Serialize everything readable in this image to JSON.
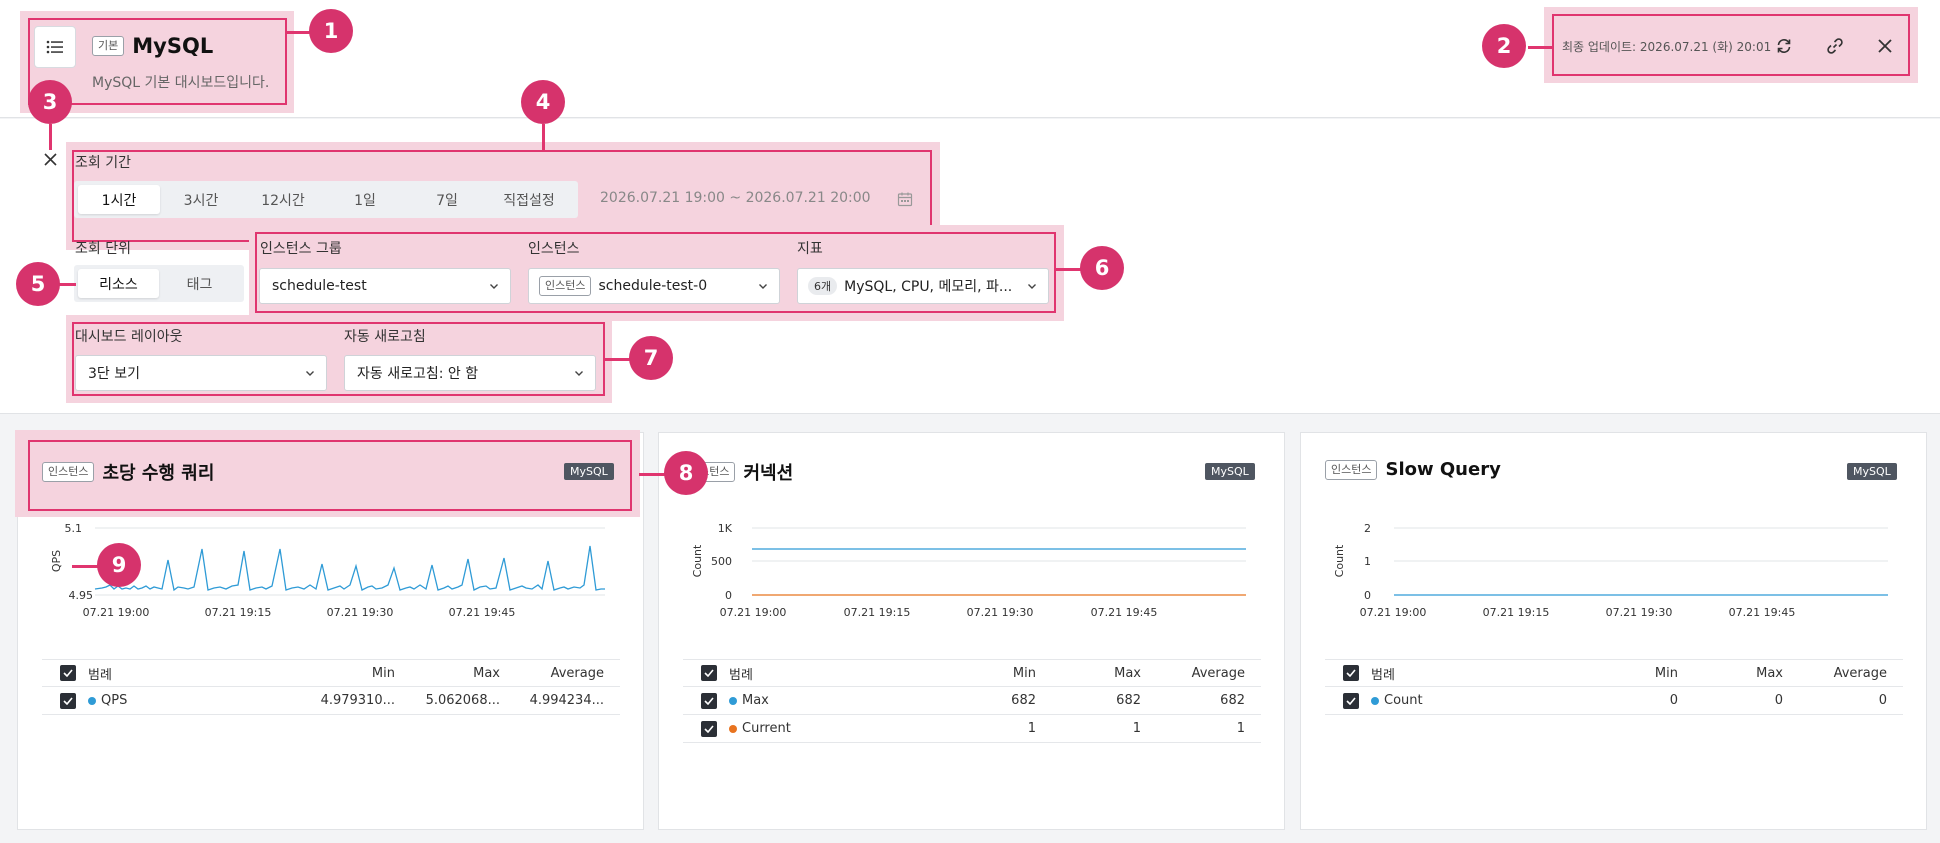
{
  "header": {
    "tag": "기본",
    "title": "MySQL",
    "subtitle": "MySQL 기본 대시보드입니다.",
    "updated": "최종 업데이트: 2026.07.21 (화) 20:01"
  },
  "period": {
    "label": "조회 기간",
    "options": [
      "1시간",
      "3시간",
      "12시간",
      "1일",
      "7일",
      "직접설정"
    ],
    "selected": "1시간",
    "range": "2026.07.21 19:00 ~ 2026.07.21 20:00"
  },
  "unit": {
    "label": "조회 단위",
    "options": [
      "리소스",
      "태그"
    ],
    "selected": "리소스"
  },
  "instance_group": {
    "label": "인스턴스 그룹",
    "value": "schedule-test"
  },
  "instance": {
    "label": "인스턴스",
    "tag": "인스턴스",
    "value": "schedule-test-0"
  },
  "metric": {
    "label": "지표",
    "count": "6개",
    "value": "MySQL, CPU, 메모리, 파..."
  },
  "layout": {
    "label": "대시보드 레이아웃",
    "value": "3단 보기"
  },
  "refresh": {
    "label": "자동 새로고침",
    "value": "자동 새로고침: 안 함"
  },
  "markers": [
    "1",
    "2",
    "3",
    "4",
    "5",
    "6",
    "7",
    "8",
    "9"
  ],
  "legend_headers": {
    "name": "범례",
    "min": "Min",
    "max": "Max",
    "avg": "Average"
  },
  "cards": [
    {
      "tag": "인스턴스",
      "title": "초당 수행 쿼리",
      "badge": "MySQL",
      "ylabel": "QPS",
      "yticks": [
        "5.1",
        "4.95"
      ],
      "xticks": [
        "07.21 19:00",
        "07.21 19:15",
        "07.21 19:30",
        "07.21 19:45"
      ],
      "legend": [
        {
          "name": "QPS",
          "color": "#2f9bd6",
          "min": "4.979310...",
          "max": "5.062068...",
          "avg": "4.994234..."
        }
      ]
    },
    {
      "tag": "인스턴스",
      "title": "커넥션",
      "badge": "MySQL",
      "ylabel": "Count",
      "yticks": [
        "1K",
        "500",
        "0"
      ],
      "xticks": [
        "07.21 19:00",
        "07.21 19:15",
        "07.21 19:30",
        "07.21 19:45"
      ],
      "legend": [
        {
          "name": "Max",
          "color": "#2f9bd6",
          "min": "682",
          "max": "682",
          "avg": "682"
        },
        {
          "name": "Current",
          "color": "#e8731f",
          "min": "1",
          "max": "1",
          "avg": "1"
        }
      ]
    },
    {
      "tag": "인스턴스",
      "title": "Slow Query",
      "badge": "MySQL",
      "ylabel": "Count",
      "yticks": [
        "2",
        "1",
        "0"
      ],
      "xticks": [
        "07.21 19:00",
        "07.21 19:15",
        "07.21 19:30",
        "07.21 19:45"
      ],
      "legend": [
        {
          "name": "Count",
          "color": "#2f9bd6",
          "min": "0",
          "max": "0",
          "avg": "0"
        }
      ]
    }
  ],
  "colors": {
    "accent": "#d6336c",
    "line_blue": "#2f9bd6",
    "line_orange": "#e8731f",
    "badge": "#4f5661"
  }
}
